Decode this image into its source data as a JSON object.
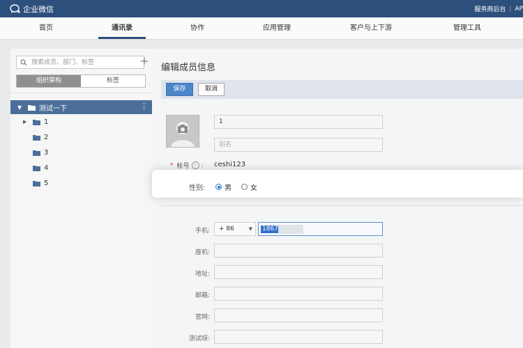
{
  "header": {
    "logo_text": "企业微信",
    "service_link": "服务商后台",
    "separator": "|",
    "api_link": "AP"
  },
  "nav": {
    "items": [
      {
        "label": "首页",
        "active": false
      },
      {
        "label": "通讯录",
        "active": true
      },
      {
        "label": "协作",
        "active": false
      },
      {
        "label": "应用管理",
        "active": false
      },
      {
        "label": "客户与上下游",
        "active": false
      },
      {
        "label": "管理工具",
        "active": false
      }
    ]
  },
  "sidebar": {
    "search_placeholder": "搜索成员、部门、标签",
    "add_symbol": "+",
    "tabs": [
      {
        "label": "组织架构",
        "active": true
      },
      {
        "label": "标签",
        "active": false
      }
    ],
    "root": {
      "label": "测试一下",
      "expanded": true
    },
    "departments": [
      {
        "label": "1",
        "has_children": true
      },
      {
        "label": "2",
        "has_children": false
      },
      {
        "label": "3",
        "has_children": false
      },
      {
        "label": "4",
        "has_children": false
      },
      {
        "label": "5",
        "has_children": false
      }
    ]
  },
  "form": {
    "title": "编辑成员信息",
    "save_label": "保存",
    "cancel_label": "取消",
    "name_value": "1",
    "alias_placeholder": "别名",
    "account_label": "帐号",
    "account_value": "ceshi123",
    "gender_label": "性别:",
    "gender_options": [
      {
        "label": "男",
        "checked": true
      },
      {
        "label": "女",
        "checked": false
      }
    ],
    "mobile_label": "手机:",
    "country_code": "+ 86",
    "mobile_value_visible": "1867",
    "landline_label": "座机:",
    "address_label": "地址:",
    "email_label": "邮箱:",
    "website_label": "官网:",
    "custom_label": "测试呀:"
  },
  "colors": {
    "header_bg": "#2d4f7c",
    "accent": "#4a86c8",
    "tree_selected": "#4b6f9a"
  }
}
